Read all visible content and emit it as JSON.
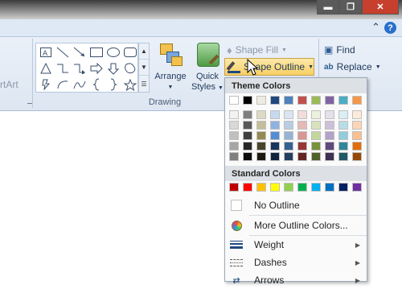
{
  "window": {
    "minimize_glyph": "▬",
    "restore_glyph": "❐",
    "close_glyph": "✕",
    "help_glyph": "?",
    "collapse_glyph": "⌃"
  },
  "ribbon": {
    "left_partial_label": "rtArt",
    "drawing_group_label": "Drawing",
    "arrange": {
      "label": "Arrange",
      "icon": "arrange-icon"
    },
    "quick_styles": {
      "label_line1": "Quick",
      "label_line2": "Styles"
    },
    "shape_fill": {
      "label": "Shape Fill",
      "icon": "paint-bucket-icon"
    },
    "shape_outline": {
      "label": "Shape Outline",
      "icon": "pencil-outline-icon"
    },
    "find": {
      "label": "Find",
      "icon": "binoculars-icon"
    },
    "replace": {
      "label": "Replace",
      "icon": "replace-icon"
    }
  },
  "colors": {
    "accent": "#f9d97c",
    "menu_header_bg": "#dde1e6"
  },
  "menu": {
    "theme_colors_header": "Theme Colors",
    "standard_colors_header": "Standard Colors",
    "theme_top_row": [
      "#ffffff",
      "#000000",
      "#eeece1",
      "#1f497d",
      "#4f81bd",
      "#c0504d",
      "#9bbb59",
      "#8064a2",
      "#4bacc6",
      "#f79646"
    ],
    "theme_shades": [
      [
        "#f2f2f2",
        "#7f7f7f",
        "#ddd9c3",
        "#c6d9f0",
        "#dbe5f1",
        "#f2dcdb",
        "#ebf1dd",
        "#e5e0ec",
        "#dbeef3",
        "#fdeada"
      ],
      [
        "#d8d8d8",
        "#595959",
        "#c4bd97",
        "#8db3e2",
        "#b8cce4",
        "#e5b9b7",
        "#d7e3bc",
        "#ccc1d9",
        "#b7dde8",
        "#fbd5b5"
      ],
      [
        "#bfbfbf",
        "#3f3f3f",
        "#938953",
        "#548dd4",
        "#95b3d7",
        "#d99694",
        "#c3d69b",
        "#b2a2c7",
        "#92cddc",
        "#fac08f"
      ],
      [
        "#a5a5a5",
        "#262626",
        "#494429",
        "#17365d",
        "#366092",
        "#953734",
        "#76923c",
        "#5f497a",
        "#31859b",
        "#e36c09"
      ],
      [
        "#7f7f7f",
        "#0c0c0c",
        "#1d1b10",
        "#0f243e",
        "#244061",
        "#632423",
        "#4f6128",
        "#3f3151",
        "#205867",
        "#974806"
      ]
    ],
    "standard_colors": [
      "#c00000",
      "#ff0000",
      "#ffc000",
      "#ffff00",
      "#92d050",
      "#00b050",
      "#00b0f0",
      "#0070c0",
      "#002060",
      "#7030a0"
    ],
    "no_outline": "No Outline",
    "more_colors": "More Outline Colors...",
    "weight": "Weight",
    "dashes": "Dashes",
    "arrows": "Arrows"
  }
}
